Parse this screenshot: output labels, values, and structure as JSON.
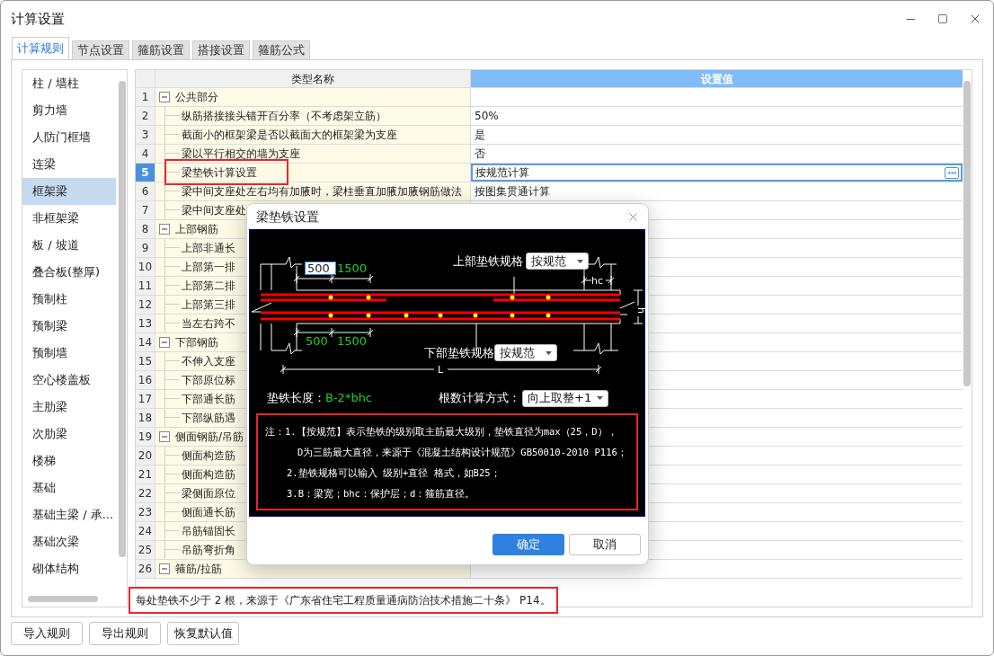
{
  "window": {
    "title": "计算设置"
  },
  "tabs": [
    {
      "label": "计算规则",
      "selected": true
    },
    {
      "label": "节点设置",
      "selected": false
    },
    {
      "label": "箍筋设置",
      "selected": false
    },
    {
      "label": "搭接设置",
      "selected": false
    },
    {
      "label": "箍筋公式",
      "selected": false
    }
  ],
  "sidebar": {
    "items": [
      {
        "label": "柱 / 墙柱",
        "selected": false
      },
      {
        "label": "剪力墙",
        "selected": false
      },
      {
        "label": "人防门框墙",
        "selected": false
      },
      {
        "label": "连梁",
        "selected": false
      },
      {
        "label": "框架梁",
        "selected": true
      },
      {
        "label": "非框架梁",
        "selected": false
      },
      {
        "label": "板 / 坡道",
        "selected": false
      },
      {
        "label": "叠合板(整厚)",
        "selected": false
      },
      {
        "label": "预制柱",
        "selected": false
      },
      {
        "label": "预制梁",
        "selected": false
      },
      {
        "label": "预制墙",
        "selected": false
      },
      {
        "label": "空心楼盖板",
        "selected": false
      },
      {
        "label": "主肋梁",
        "selected": false
      },
      {
        "label": "次肋梁",
        "selected": false
      },
      {
        "label": "楼梯",
        "selected": false
      },
      {
        "label": "基础",
        "selected": false
      },
      {
        "label": "基础主梁 / 承...",
        "selected": false
      },
      {
        "label": "基础次梁",
        "selected": false
      },
      {
        "label": "砌体结构",
        "selected": false
      }
    ]
  },
  "table": {
    "columns": [
      "类型名称",
      "设置值"
    ],
    "groups": [
      {
        "number": "1",
        "label": "公共部分",
        "expanded": true,
        "children": [
          {
            "number": "2",
            "label": "纵筋搭接接头错开百分率（不考虑架立筋）",
            "value": "50%",
            "selected": false
          },
          {
            "number": "3",
            "label": "截面小的框架梁是否以截面大的框架梁为支座",
            "value": "是",
            "selected": false
          },
          {
            "number": "4",
            "label": "梁以平行相交的墙为支座",
            "value": "否",
            "selected": false
          },
          {
            "number": "5",
            "label": "梁垫铁计算设置",
            "value": "按规范计算",
            "selected": true
          },
          {
            "number": "6",
            "label": "梁中间支座处左右均有加腋时，梁柱垂直加腋加腋钢筋做法",
            "value": "按图集贯通计算",
            "selected": false
          },
          {
            "number": "7",
            "label": "梁中间支座处",
            "selected": false
          }
        ]
      },
      {
        "number": "8",
        "label": "上部钢筋",
        "expanded": true,
        "children": [
          {
            "number": "9",
            "label": "上部非通长",
            "selected": false
          },
          {
            "number": "10",
            "label": "上部第一排",
            "selected": false
          },
          {
            "number": "11",
            "label": "上部第二排",
            "selected": false
          },
          {
            "number": "12",
            "label": "上部第三排",
            "selected": false
          },
          {
            "number": "13",
            "label": "当左右跨不",
            "selected": false
          }
        ]
      },
      {
        "number": "14",
        "label": "下部钢筋",
        "expanded": true,
        "children": [
          {
            "number": "15",
            "label": "不伸入支座",
            "selected": false
          },
          {
            "number": "16",
            "label": "下部原位标",
            "selected": false
          },
          {
            "number": "17",
            "label": "下部通长筋",
            "selected": false
          },
          {
            "number": "18",
            "label": "下部纵筋遇",
            "selected": false
          }
        ]
      },
      {
        "number": "19",
        "label": "侧面钢筋/吊筋",
        "expanded": true,
        "children": [
          {
            "number": "20",
            "label": "侧面构造筋",
            "selected": false
          },
          {
            "number": "21",
            "label": "侧面构造筋",
            "selected": false
          },
          {
            "number": "22",
            "label": "梁侧面原位",
            "selected": false
          },
          {
            "number": "23",
            "label": "侧面通长筋",
            "selected": false
          },
          {
            "number": "24",
            "label": "吊筋锚固长",
            "selected": false
          },
          {
            "number": "25",
            "label": "吊筋弯折角",
            "selected": false
          }
        ]
      },
      {
        "number": "26",
        "label": "箍筋/拉筋",
        "expanded": true
      }
    ]
  },
  "dialog": {
    "title": "梁垫铁设置",
    "dimension_labels": [
      "hc",
      "L",
      "h"
    ],
    "top": {
      "label": "上部垫铁规格",
      "select": "按规范",
      "offset_input": "500",
      "offset_second": "1500"
    },
    "bottom": {
      "label": "下部垫铁规格",
      "select": "按规范",
      "offset_first": "500",
      "offset_second": "1500"
    },
    "length": {
      "label": "垫铁长度：",
      "value": "B-2*bhc"
    },
    "count_method": {
      "label": "根数计算方式：",
      "select": "向上取整+1"
    },
    "notes": [
      "注：1.【按规范】表示垫铁的级别取主筋最大级别，垫铁直径为max（25，D），",
      "D为三筋最大直径，来源于《混凝土结构设计规范》GB50010-2010 P116；",
      "2.垫铁规格可以输入 级别+直径 格式，如B25；",
      "3.B：梁宽；bhc：保护层；d：箍筋直径。"
    ],
    "buttons": [
      {
        "label": "确定",
        "primary": true
      },
      {
        "label": "取消",
        "primary": false
      }
    ]
  },
  "annotation": {
    "text": "每处垫铁不少于 2 根，来源于《广东省住宅工程质量通病防治技术措施二十条》 P14。"
  },
  "footer_buttons": [
    "导入规则",
    "导出规则",
    "恢复默认值"
  ]
}
